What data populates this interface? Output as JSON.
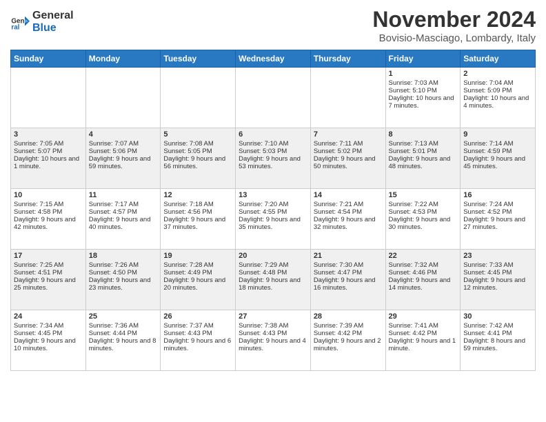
{
  "logo": {
    "line1": "General",
    "line2": "Blue"
  },
  "title": "November 2024",
  "location": "Bovisio-Masciago, Lombardy, Italy",
  "days_header": [
    "Sunday",
    "Monday",
    "Tuesday",
    "Wednesday",
    "Thursday",
    "Friday",
    "Saturday"
  ],
  "weeks": [
    [
      {
        "day": "",
        "info": ""
      },
      {
        "day": "",
        "info": ""
      },
      {
        "day": "",
        "info": ""
      },
      {
        "day": "",
        "info": ""
      },
      {
        "day": "",
        "info": ""
      },
      {
        "day": "1",
        "info": "Sunrise: 7:03 AM\nSunset: 5:10 PM\nDaylight: 10 hours and 7 minutes."
      },
      {
        "day": "2",
        "info": "Sunrise: 7:04 AM\nSunset: 5:09 PM\nDaylight: 10 hours and 4 minutes."
      }
    ],
    [
      {
        "day": "3",
        "info": "Sunrise: 7:05 AM\nSunset: 5:07 PM\nDaylight: 10 hours and 1 minute."
      },
      {
        "day": "4",
        "info": "Sunrise: 7:07 AM\nSunset: 5:06 PM\nDaylight: 9 hours and 59 minutes."
      },
      {
        "day": "5",
        "info": "Sunrise: 7:08 AM\nSunset: 5:05 PM\nDaylight: 9 hours and 56 minutes."
      },
      {
        "day": "6",
        "info": "Sunrise: 7:10 AM\nSunset: 5:03 PM\nDaylight: 9 hours and 53 minutes."
      },
      {
        "day": "7",
        "info": "Sunrise: 7:11 AM\nSunset: 5:02 PM\nDaylight: 9 hours and 50 minutes."
      },
      {
        "day": "8",
        "info": "Sunrise: 7:13 AM\nSunset: 5:01 PM\nDaylight: 9 hours and 48 minutes."
      },
      {
        "day": "9",
        "info": "Sunrise: 7:14 AM\nSunset: 4:59 PM\nDaylight: 9 hours and 45 minutes."
      }
    ],
    [
      {
        "day": "10",
        "info": "Sunrise: 7:15 AM\nSunset: 4:58 PM\nDaylight: 9 hours and 42 minutes."
      },
      {
        "day": "11",
        "info": "Sunrise: 7:17 AM\nSunset: 4:57 PM\nDaylight: 9 hours and 40 minutes."
      },
      {
        "day": "12",
        "info": "Sunrise: 7:18 AM\nSunset: 4:56 PM\nDaylight: 9 hours and 37 minutes."
      },
      {
        "day": "13",
        "info": "Sunrise: 7:20 AM\nSunset: 4:55 PM\nDaylight: 9 hours and 35 minutes."
      },
      {
        "day": "14",
        "info": "Sunrise: 7:21 AM\nSunset: 4:54 PM\nDaylight: 9 hours and 32 minutes."
      },
      {
        "day": "15",
        "info": "Sunrise: 7:22 AM\nSunset: 4:53 PM\nDaylight: 9 hours and 30 minutes."
      },
      {
        "day": "16",
        "info": "Sunrise: 7:24 AM\nSunset: 4:52 PM\nDaylight: 9 hours and 27 minutes."
      }
    ],
    [
      {
        "day": "17",
        "info": "Sunrise: 7:25 AM\nSunset: 4:51 PM\nDaylight: 9 hours and 25 minutes."
      },
      {
        "day": "18",
        "info": "Sunrise: 7:26 AM\nSunset: 4:50 PM\nDaylight: 9 hours and 23 minutes."
      },
      {
        "day": "19",
        "info": "Sunrise: 7:28 AM\nSunset: 4:49 PM\nDaylight: 9 hours and 20 minutes."
      },
      {
        "day": "20",
        "info": "Sunrise: 7:29 AM\nSunset: 4:48 PM\nDaylight: 9 hours and 18 minutes."
      },
      {
        "day": "21",
        "info": "Sunrise: 7:30 AM\nSunset: 4:47 PM\nDaylight: 9 hours and 16 minutes."
      },
      {
        "day": "22",
        "info": "Sunrise: 7:32 AM\nSunset: 4:46 PM\nDaylight: 9 hours and 14 minutes."
      },
      {
        "day": "23",
        "info": "Sunrise: 7:33 AM\nSunset: 4:45 PM\nDaylight: 9 hours and 12 minutes."
      }
    ],
    [
      {
        "day": "24",
        "info": "Sunrise: 7:34 AM\nSunset: 4:45 PM\nDaylight: 9 hours and 10 minutes."
      },
      {
        "day": "25",
        "info": "Sunrise: 7:36 AM\nSunset: 4:44 PM\nDaylight: 9 hours and 8 minutes."
      },
      {
        "day": "26",
        "info": "Sunrise: 7:37 AM\nSunset: 4:43 PM\nDaylight: 9 hours and 6 minutes."
      },
      {
        "day": "27",
        "info": "Sunrise: 7:38 AM\nSunset: 4:43 PM\nDaylight: 9 hours and 4 minutes."
      },
      {
        "day": "28",
        "info": "Sunrise: 7:39 AM\nSunset: 4:42 PM\nDaylight: 9 hours and 2 minutes."
      },
      {
        "day": "29",
        "info": "Sunrise: 7:41 AM\nSunset: 4:42 PM\nDaylight: 9 hours and 1 minute."
      },
      {
        "day": "30",
        "info": "Sunrise: 7:42 AM\nSunset: 4:41 PM\nDaylight: 8 hours and 59 minutes."
      }
    ]
  ]
}
